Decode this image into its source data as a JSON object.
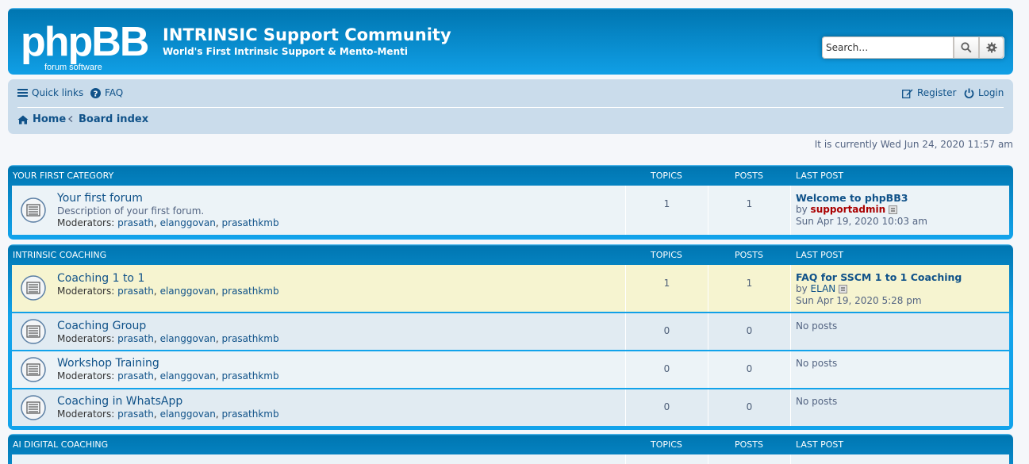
{
  "header": {
    "logo_text": "phpBB",
    "logo_sub": "forum software",
    "site_title": "INTRINSIC Support Community",
    "site_description": "World's First Intrinsic Support & Mento-Menti",
    "search_placeholder": "Search…",
    "icons": [
      "search-icon",
      "gear-icon"
    ]
  },
  "navbar": {
    "quick_links": "Quick links",
    "faq": "FAQ",
    "register": "Register",
    "login": "Login",
    "home": "Home",
    "board_index": "Board index",
    "icons": [
      "bars-icon",
      "question-circle-icon",
      "edit-icon",
      "power-icon",
      "home-icon",
      "chevron-left-icon"
    ]
  },
  "current_time": "It is currently Wed Jun 24, 2020 11:57 am",
  "column_headers": {
    "topics": "TOPICS",
    "posts": "POSTS",
    "last_post": "LAST POST"
  },
  "colors": {
    "brand_blue": "#12A3EB",
    "nav_bg": "#cadceb",
    "link": "#105289",
    "highlight_row": "#f6f4d0",
    "admin": "#aa0000"
  },
  "categories": [
    {
      "name": "YOUR FIRST CATEGORY",
      "forums": [
        {
          "name": "Your first forum",
          "description": "Description of your first forum.",
          "moderators_label": "Moderators:",
          "moderators": [
            "prasath",
            "elanggovan",
            "prasathkmb"
          ],
          "topics": "1",
          "posts": "1",
          "last_post": {
            "title": "Welcome to phpBB3",
            "by": "by",
            "author": "supportadmin",
            "date": "Sun Apr 19, 2020 10:03 am"
          }
        }
      ]
    },
    {
      "name": "INTRINSIC COACHING",
      "forums": [
        {
          "name": "Coaching 1 to 1",
          "moderators_label": "Moderators:",
          "moderators": [
            "prasath",
            "elanggovan",
            "prasathkmb"
          ],
          "topics": "1",
          "posts": "1",
          "last_post": {
            "title": "FAQ for SSCM 1 to 1 Coaching",
            "by": "by",
            "author": "ELAN",
            "date": "Sun Apr 19, 2020 5:28 pm"
          }
        },
        {
          "name": "Coaching Group",
          "moderators_label": "Moderators:",
          "moderators": [
            "prasath",
            "elanggovan",
            "prasathkmb"
          ],
          "topics": "0",
          "posts": "0",
          "last_post": {
            "none": "No posts"
          }
        },
        {
          "name": "Workshop Training",
          "moderators_label": "Moderators:",
          "moderators": [
            "prasath",
            "elanggovan",
            "prasathkmb"
          ],
          "topics": "0",
          "posts": "0",
          "last_post": {
            "none": "No posts"
          }
        },
        {
          "name": "Coaching in WhatsApp",
          "moderators_label": "Moderators:",
          "moderators": [
            "prasath",
            "elanggovan",
            "prasathkmb"
          ],
          "topics": "0",
          "posts": "0",
          "last_post": {
            "none": "No posts"
          }
        }
      ]
    },
    {
      "name": "AI DIGITAL COACHING",
      "forums": []
    }
  ]
}
